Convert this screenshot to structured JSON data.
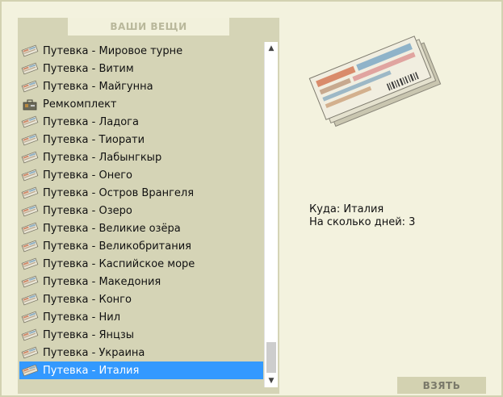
{
  "panel": {
    "title": "ВАШИ ВЕЩИ"
  },
  "items": [
    {
      "label": "Путевка - Мировое турне",
      "icon": "ticket-icon",
      "selected": false
    },
    {
      "label": "Путевка - Витим",
      "icon": "ticket-icon",
      "selected": false
    },
    {
      "label": "Путевка - Майгунна",
      "icon": "ticket-icon",
      "selected": false
    },
    {
      "label": "Ремкомплект",
      "icon": "repair-kit-icon",
      "selected": false
    },
    {
      "label": "Путевка - Ладога",
      "icon": "ticket-icon",
      "selected": false
    },
    {
      "label": "Путевка - Тиорати",
      "icon": "ticket-icon",
      "selected": false
    },
    {
      "label": "Путевка - Лабынгкыр",
      "icon": "ticket-icon",
      "selected": false
    },
    {
      "label": "Путевка - Онего",
      "icon": "ticket-icon",
      "selected": false
    },
    {
      "label": "Путевка - Остров Врангеля",
      "icon": "ticket-icon",
      "selected": false
    },
    {
      "label": "Путевка - Озеро",
      "icon": "ticket-icon",
      "selected": false
    },
    {
      "label": "Путевка - Великие озёра",
      "icon": "ticket-icon",
      "selected": false
    },
    {
      "label": "Путевка - Великобритания",
      "icon": "ticket-icon",
      "selected": false
    },
    {
      "label": "Путевка - Каспийское море",
      "icon": "ticket-icon",
      "selected": false
    },
    {
      "label": "Путевка - Македония",
      "icon": "ticket-icon",
      "selected": false
    },
    {
      "label": "Путевка - Конго",
      "icon": "ticket-icon",
      "selected": false
    },
    {
      "label": "Путевка - Нил",
      "icon": "ticket-icon",
      "selected": false
    },
    {
      "label": "Путевка - Янцзы",
      "icon": "ticket-icon",
      "selected": false
    },
    {
      "label": "Путевка - Украина",
      "icon": "ticket-icon",
      "selected": false
    },
    {
      "label": "Путевка - Италия",
      "icon": "ticket-icon",
      "selected": true
    }
  ],
  "details": {
    "destination": "Куда: Италия",
    "days": "На сколько дней: 3"
  },
  "take_button": {
    "label": "ВЗЯТЬ"
  },
  "colors": {
    "background": "#f2f1dc",
    "panel": "#d5d4b6",
    "selection": "#3399ff",
    "button": "#d3d2b1"
  }
}
